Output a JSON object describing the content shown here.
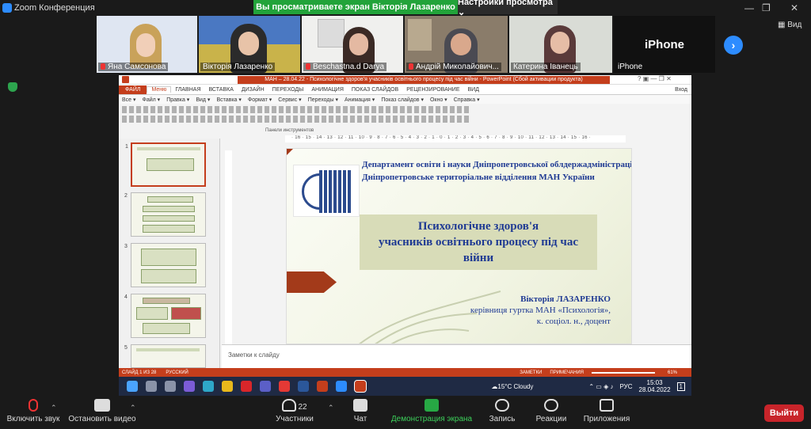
{
  "window": {
    "app_title": "Zoom Конференция",
    "min": "—",
    "max": "❐",
    "close": "✕"
  },
  "share_banner": "Вы просматриваете экран Вікторія Лазаренко",
  "view_settings": "Настройки просмотра ⌄",
  "participants": [
    {
      "name": "Яна Самсонова",
      "bg": "#dfe6f2"
    },
    {
      "name": "Вікторія Лазаренко",
      "bg": "#c9b34a"
    },
    {
      "name": "Beschastna.d Darya",
      "bg": "#f0f0ee"
    },
    {
      "name": "Андрій Миколайович...",
      "bg": "#8a7c6a"
    },
    {
      "name": "Катерина Іванець",
      "bg": "#d9dcd6"
    },
    {
      "name": "iPhone",
      "big_label": "iPhone",
      "bg": "#111111"
    }
  ],
  "view_button": "Вид",
  "powerpoint": {
    "title": "МАН – 28.04.22 - Психологічне здоров'я учасників освітнього процесу під час війни - PowerPoint (Сбой активации продукта)",
    "title_controls": "? ▣ — ❐ ✕",
    "login": "Вход",
    "tabs": [
      "ФАЙЛ",
      "Меню",
      "ГЛАВНАЯ",
      "ВСТАВКА",
      "ДИЗАЙН",
      "ПЕРЕХОДЫ",
      "АНИМАЦИЯ",
      "ПОКАЗ СЛАЙДОВ",
      "РЕЦЕНЗИРОВАНИЕ",
      "ВИД"
    ],
    "menus": [
      "Все ▾",
      "Файл ▾",
      "Правка ▾",
      "Вид ▾",
      "Вставка ▾",
      "Формат ▾",
      "Сервис ▾",
      "Переходы ▾",
      "Анимация ▾",
      "Показ слайдов ▾",
      "Окно ▾",
      "Справка ▾"
    ],
    "toolbar_label": "Панели инструментов",
    "ruler_top": "· 16 · 15 · 14 · 13 · 12 · 11 · 10 · 9 · 8 · 7 · 6 · 5 · 4 · 3 · 2 · 1 · 0 · 1 · 2 · 3 · 4 · 5 · 6 · 7 · 8 · 9 · 10 · 11 · 12 · 13 · 14 · 15 · 16 ·",
    "thumb_numbers": [
      "1",
      "2",
      "3",
      "4",
      "5"
    ],
    "slide": {
      "org_line1": "Департамент освіти і науки Дніпропетровської облдержадміністрації",
      "org_line2": "Дніпропетровське територіальне відділення МАН України",
      "title_line1": "Психологічне здоров'я",
      "title_line2": "учасників освітнього процесу під час",
      "title_line3": "війни",
      "author_name": "Вікторія ЛАЗАРЕНКО",
      "author_role": "керівниця гуртка МАН «Психологія»,",
      "author_degree": "к. соціол. н., доцент"
    },
    "notes_placeholder": "Заметки к слайду",
    "status_slide": "СЛАЙД 1 ИЗ 28",
    "status_lang": "РУССКИЙ",
    "status_notes": "ЗАМЕТКИ",
    "status_comments": "ПРИМЕЧАНИЯ",
    "zoom_level": "61%"
  },
  "taskbar": {
    "weather": "15°C Cloudy",
    "lang": "РУС",
    "time": "15:03",
    "date": "28.04.2022",
    "notif_count": "1"
  },
  "zoom_controls": {
    "mute": "Включить звук",
    "video": "Остановить видео",
    "participants": "Участники",
    "participants_count": "22",
    "chat": "Чат",
    "share": "Демонстрация экрана",
    "record": "Запись",
    "reactions": "Реакции",
    "apps": "Приложения",
    "leave": "Выйти"
  }
}
